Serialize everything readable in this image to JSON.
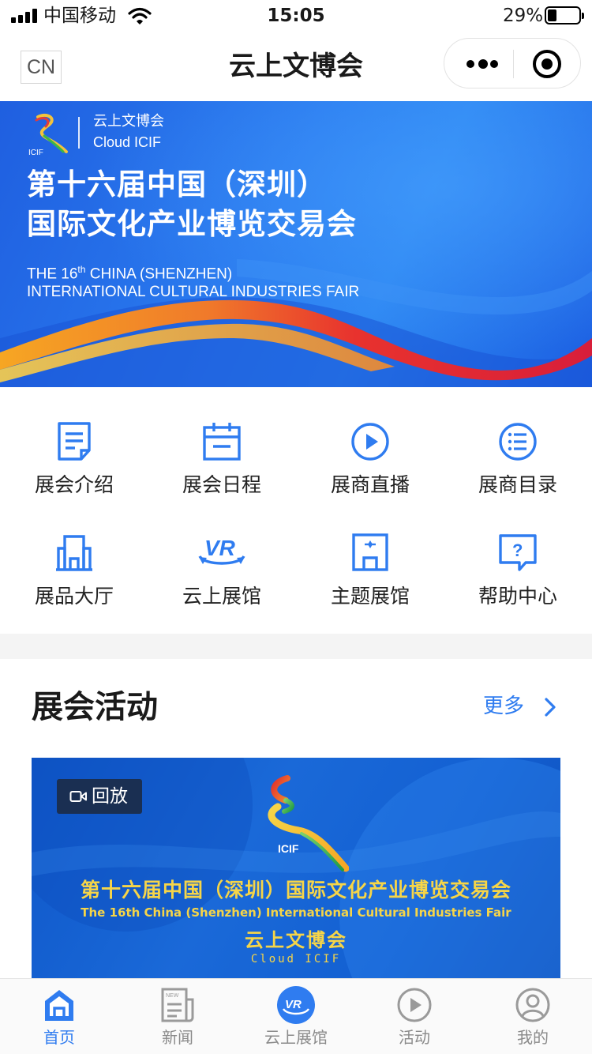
{
  "status_bar": {
    "carrier": "中国移动",
    "time": "15:05",
    "battery_percent": "29%",
    "battery_level": 0.29
  },
  "nav": {
    "lang_badge": "CN",
    "title": "云上文博会"
  },
  "banner": {
    "logo_text": "ICIF",
    "brand_cn": "云上文博会",
    "brand_en": "Cloud ICIF",
    "title_line1": "第十六届中国（深圳）",
    "title_line2": "国际文化产业博览交易会",
    "en_line1_prefix": "THE 16",
    "en_line1_sup": "th",
    "en_line1_suffix": " CHINA (SHENZHEN)",
    "en_line2": "INTERNATIONAL CULTURAL INDUSTRIES FAIR"
  },
  "grid": {
    "items": [
      {
        "label": "展会介绍",
        "icon": "document-icon"
      },
      {
        "label": "展会日程",
        "icon": "calendar-icon"
      },
      {
        "label": "展商直播",
        "icon": "play-icon"
      },
      {
        "label": "展商目录",
        "icon": "list-icon"
      },
      {
        "label": "展品大厅",
        "icon": "building-icon"
      },
      {
        "label": "云上展馆",
        "icon": "vr-icon"
      },
      {
        "label": "主题展馆",
        "icon": "theme-hall-icon"
      },
      {
        "label": "帮助中心",
        "icon": "help-icon"
      }
    ]
  },
  "activities": {
    "title": "展会活动",
    "more": "更多",
    "card": {
      "badge": "回放",
      "logo_text": "ICIF",
      "title_cn": "第十六届中国（深圳）国际文化产业博览交易会",
      "title_en": "The 16th China (Shenzhen) International Cultural Industries Fair",
      "brand_cn": "云上文博会",
      "brand_en": "Cloud ICIF"
    }
  },
  "tabbar": {
    "tabs": [
      {
        "label": "首页",
        "icon": "home-icon",
        "active": true
      },
      {
        "label": "新闻",
        "icon": "news-icon",
        "icon_badge": "NEW",
        "active": false
      },
      {
        "label": "云上展馆",
        "icon": "vr-icon",
        "icon_badge": "VR",
        "active": false
      },
      {
        "label": "活动",
        "icon": "play-icon",
        "active": false
      },
      {
        "label": "我的",
        "icon": "profile-icon",
        "active": false
      }
    ]
  },
  "colors": {
    "accent": "#2f7cf0",
    "banner_blue": "#2a7bef",
    "card_gold": "#f6d548",
    "inactive": "#8a8a8a"
  }
}
